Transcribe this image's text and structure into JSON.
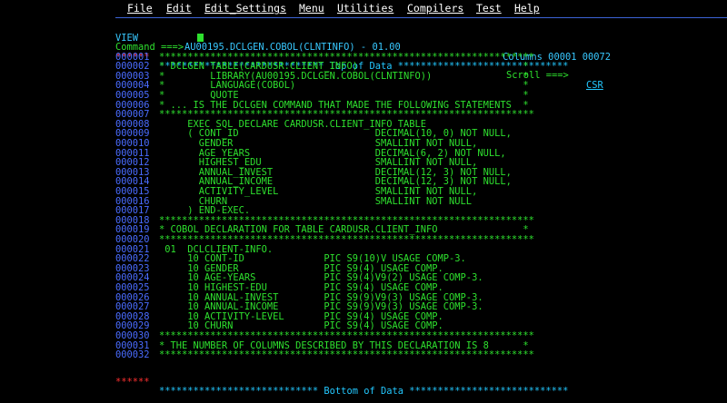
{
  "menu": [
    "File",
    "Edit",
    "Edit_Settings",
    "Menu",
    "Utilities",
    "Compilers",
    "Test",
    "Help"
  ],
  "header": {
    "mode": "VIEW",
    "dataset": "AU00195.DCLGEN.COBOL(CLNTINFO) - 01.00",
    "columns": "Columns 00001 00072"
  },
  "command": {
    "label": "Command ===>",
    "value": ""
  },
  "scroll": {
    "label": "Scroll ===>",
    "value": "CSR"
  },
  "top_marker": {
    "seq": "******",
    "text": "***************************** Top of Data ******************************"
  },
  "bottom_marker": {
    "seq": "******",
    "text": "**************************** Bottom of Data ****************************"
  },
  "lines": [
    {
      "seq": "000001",
      "text": "******************************************************************"
    },
    {
      "seq": "000002",
      "text": "* DCLGEN TABLE(CARDUSR.CLIENT_INFO)                             *"
    },
    {
      "seq": "000003",
      "text": "*        LIBRARY(AU00195.DCLGEN.COBOL(CLNTINFO))                *"
    },
    {
      "seq": "000004",
      "text": "*        LANGUAGE(COBOL)                                        *"
    },
    {
      "seq": "000005",
      "text": "*        QUOTE                                                  *"
    },
    {
      "seq": "000006",
      "text": "* ... IS THE DCLGEN COMMAND THAT MADE THE FOLLOWING STATEMENTS  *"
    },
    {
      "seq": "000007",
      "text": "******************************************************************"
    },
    {
      "seq": "000008",
      "text": "     EXEC SQL DECLARE CARDUSR.CLIENT_INFO TABLE"
    },
    {
      "seq": "000009",
      "text": "     ( CONT_ID                        DECIMAL(10, 0) NOT NULL,"
    },
    {
      "seq": "000010",
      "text": "       GENDER                         SMALLINT NOT NULL,"
    },
    {
      "seq": "000011",
      "text": "       AGE_YEARS                      DECIMAL(6, 2) NOT NULL,"
    },
    {
      "seq": "000012",
      "text": "       HIGHEST_EDU                    SMALLINT NOT NULL,"
    },
    {
      "seq": "000013",
      "text": "       ANNUAL_INVEST                  DECIMAL(12, 3) NOT NULL,"
    },
    {
      "seq": "000014",
      "text": "       ANNUAL_INCOME                  DECIMAL(12, 3) NOT NULL,"
    },
    {
      "seq": "000015",
      "text": "       ACTIVITY_LEVEL                 SMALLINT NOT NULL,"
    },
    {
      "seq": "000016",
      "text": "       CHURN                          SMALLINT NOT NULL"
    },
    {
      "seq": "000017",
      "text": "     ) END-EXEC."
    },
    {
      "seq": "000018",
      "text": "******************************************************************"
    },
    {
      "seq": "000019",
      "text": "* COBOL DECLARATION FOR TABLE CARDUSR.CLIENT_INFO               *"
    },
    {
      "seq": "000020",
      "text": "******************************************************************"
    },
    {
      "seq": "000021",
      "text": " 01  DCLCLIENT-INFO."
    },
    {
      "seq": "000022",
      "text": "     10 CONT-ID              PIC S9(10)V USAGE COMP-3."
    },
    {
      "seq": "000023",
      "text": "     10 GENDER               PIC S9(4) USAGE COMP."
    },
    {
      "seq": "000024",
      "text": "     10 AGE-YEARS            PIC S9(4)V9(2) USAGE COMP-3."
    },
    {
      "seq": "000025",
      "text": "     10 HIGHEST-EDU          PIC S9(4) USAGE COMP."
    },
    {
      "seq": "000026",
      "text": "     10 ANNUAL-INVEST        PIC S9(9)V9(3) USAGE COMP-3."
    },
    {
      "seq": "000027",
      "text": "     10 ANNUAL-INCOME        PIC S9(9)V9(3) USAGE COMP-3."
    },
    {
      "seq": "000028",
      "text": "     10 ACTIVITY-LEVEL       PIC S9(4) USAGE COMP."
    },
    {
      "seq": "000029",
      "text": "     10 CHURN                PIC S9(4) USAGE COMP."
    },
    {
      "seq": "000030",
      "text": "******************************************************************"
    },
    {
      "seq": "000031",
      "text": "* THE NUMBER OF COLUMNS DESCRIBED BY THIS DECLARATION IS 8      *"
    },
    {
      "seq": "000032",
      "text": "******************************************************************"
    }
  ],
  "colors": {
    "background": "#000000",
    "menu_text": "#ffffff",
    "code_text": "#2ee02e",
    "line_numbers": "#4a6cff",
    "markers": "#23c8ff",
    "marker_seq": "#ff3030"
  }
}
